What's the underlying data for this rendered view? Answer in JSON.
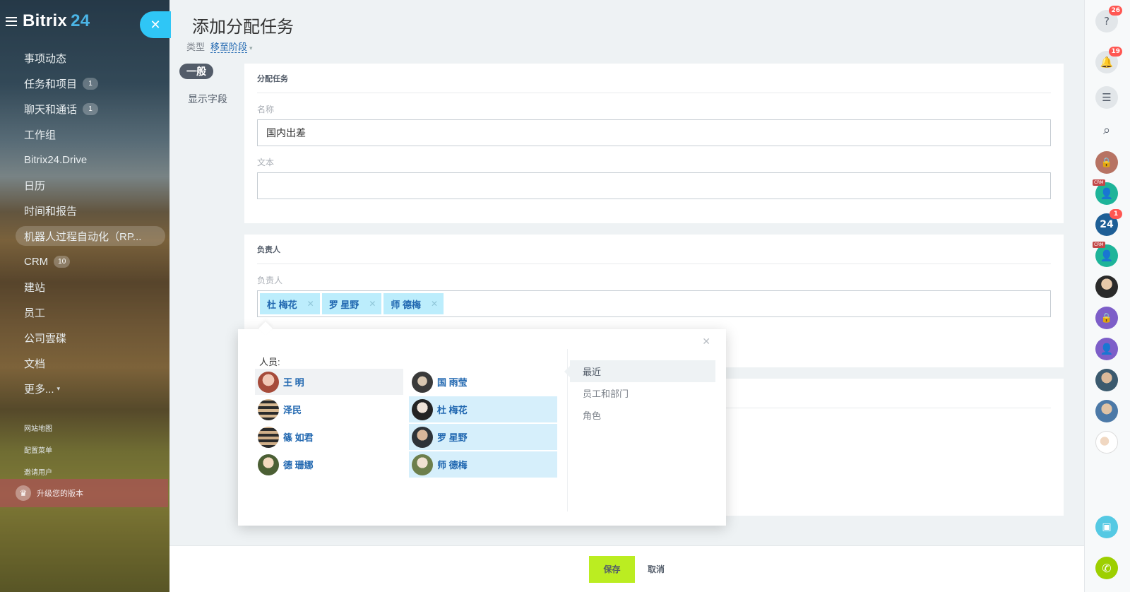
{
  "brand": {
    "name": "Bitrix",
    "version": "24",
    "accent": "#4bb5e6"
  },
  "sidebar": {
    "items": [
      {
        "label": "事项动态",
        "counter": ""
      },
      {
        "label": "任务和项目",
        "counter": "1"
      },
      {
        "label": "聊天和通话",
        "counter": "1"
      },
      {
        "label": "工作组",
        "counter": ""
      },
      {
        "label": "Bitrix24.Drive",
        "counter": ""
      },
      {
        "label": "日历",
        "counter": ""
      },
      {
        "label": "时间和报告",
        "counter": ""
      },
      {
        "label": "机器人过程自动化（RP...",
        "counter": ""
      },
      {
        "label": "CRM",
        "counter": "10"
      },
      {
        "label": "建站",
        "counter": ""
      },
      {
        "label": "员工",
        "counter": ""
      },
      {
        "label": "公司雲碟",
        "counter": ""
      },
      {
        "label": "文档",
        "counter": ""
      },
      {
        "label": "更多...",
        "counter": ""
      }
    ],
    "small_links": [
      "网站地图",
      "配置菜单",
      "邀请用户"
    ],
    "upgrade_label": "升级您的版本"
  },
  "page": {
    "title": "添加分配任务",
    "type_label": "类型",
    "type_value": "移至阶段",
    "tabs": [
      "一般",
      "显示字段"
    ]
  },
  "section_task": {
    "header": "分配任务",
    "name_label": "名称",
    "name_value": "国内出差",
    "text_label": "文本",
    "text_value": ""
  },
  "section_responsible": {
    "header": "负责人",
    "field_label": "负责人",
    "tokens": [
      "杜 梅花",
      "罗 星野",
      "师 德梅"
    ]
  },
  "popup": {
    "people_title": "人员:",
    "people_left": [
      "王 明",
      "泽民",
      "篠 如君",
      "德 珊娜"
    ],
    "people_right": [
      "国 雨莹",
      "杜 梅花",
      "罗 星野",
      "师 德梅"
    ],
    "categories": [
      "最近",
      "员工和部门",
      "角色"
    ]
  },
  "footer": {
    "save": "保存",
    "cancel": "取消",
    "save_color": "#bbed21"
  },
  "rail": {
    "help_badge": "26",
    "notif_badge": "19",
    "bitrix_label": "24",
    "bitrix_badge": "1",
    "crm_tag": "CRM"
  }
}
